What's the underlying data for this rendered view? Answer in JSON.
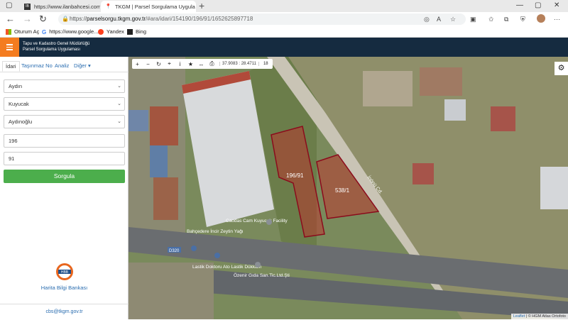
{
  "browser": {
    "tabs": [
      {
        "title": "https://www.ilanbahcesi.com/ne",
        "favicon": "ilanbahcesi-icon"
      },
      {
        "title": "TKGM | Parsel Sorgulama Uygula",
        "favicon": "location-pin-icon",
        "active": true
      }
    ],
    "url": {
      "scheme": "https://",
      "host": "parselsorgu.tkgm.gov.tr",
      "path": "/#ara/idari/154190/196/91/1652625897718"
    },
    "bookmarks": [
      {
        "label": "Oturum Aç",
        "icon": "windows-icon"
      },
      {
        "label": "https://www.google...",
        "icon": "google-icon"
      },
      {
        "label": "Yandex",
        "icon": "yandex-icon"
      },
      {
        "label": "Bing",
        "icon": "bing-icon"
      }
    ]
  },
  "header": {
    "line1": "Tapu ve Kadastro Genel Müdürlüğü",
    "line2": "Parsel Sorgulama Uygulaması"
  },
  "sidebar": {
    "tabs": [
      "İdari",
      "Taşınmaz No",
      "Analiz",
      "Diğer ▾"
    ],
    "province": "Aydın",
    "district": "Kuyucak",
    "neighborhood": "Aydınoğlu",
    "block": "196",
    "parcel": "91",
    "query_button": "Sorgula",
    "logo_text": "HBB",
    "bank_label": "Harita Bilgi Bankası",
    "email": "cbs@tkgm.gov.tr"
  },
  "map": {
    "coordinates": "37.9083 : 28.4711",
    "zoom": "18",
    "parcels": [
      "196/91",
      "538/1"
    ],
    "labels": [
      "Bahçedere İncir Zeytin Yağı",
      "Caodas Cam Kuyucak Facility",
      "Lastik Doktoru Ato Lastik Dükkanı",
      "Özenir Gıda San.Tic.Ltd.Şti",
      "İnönü Cd.",
      "D320"
    ],
    "attribution_leaflet": "Leaflet",
    "attribution_rest": "| © HGM Atlas Ortofoto"
  },
  "colors": {
    "header_bg": "#152b40",
    "menu_orange": "#f47c20",
    "query_green": "#4cae4c",
    "parcel_red": "#a0101e"
  }
}
